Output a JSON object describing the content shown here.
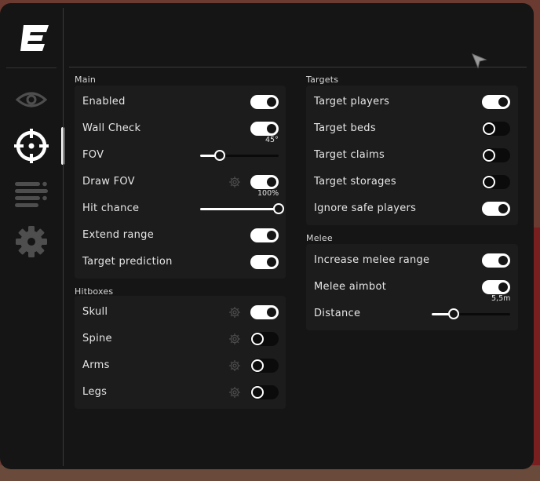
{
  "colors": {
    "accent": "#ffffff",
    "panel": "#1c1c1c",
    "window": "#151515",
    "text": "#e6e6e6"
  },
  "sidebar": {
    "logo": "E-logo",
    "items": [
      {
        "icon": "eye-icon",
        "active": false
      },
      {
        "icon": "crosshair-icon",
        "active": true
      },
      {
        "icon": "list-icon",
        "active": false
      },
      {
        "icon": "gear-icon",
        "active": false
      }
    ]
  },
  "main": {
    "title": "Main",
    "rows": [
      {
        "label": "Enabled",
        "type": "toggle",
        "on": true
      },
      {
        "label": "Wall Check",
        "type": "toggle",
        "on": true
      },
      {
        "label": "FOV",
        "type": "slider",
        "value_text": "45°",
        "fraction": 0.25
      },
      {
        "label": "Draw FOV",
        "type": "toggle",
        "on": true,
        "gear": true
      },
      {
        "label": "Hit chance",
        "type": "slider",
        "value_text": "100%",
        "fraction": 1.0
      },
      {
        "label": "Extend range",
        "type": "toggle",
        "on": true
      },
      {
        "label": "Target prediction",
        "type": "toggle",
        "on": true
      }
    ]
  },
  "hitboxes": {
    "title": "Hitboxes",
    "rows": [
      {
        "label": "Skull",
        "type": "toggle",
        "on": true,
        "gear": true
      },
      {
        "label": "Spine",
        "type": "toggle",
        "on": false,
        "gear": true
      },
      {
        "label": "Arms",
        "type": "toggle",
        "on": false,
        "gear": true
      },
      {
        "label": "Legs",
        "type": "toggle",
        "on": false,
        "gear": true
      }
    ]
  },
  "targets": {
    "title": "Targets",
    "rows": [
      {
        "label": "Target players",
        "type": "toggle",
        "on": true
      },
      {
        "label": "Target beds",
        "type": "toggle",
        "on": false
      },
      {
        "label": "Target claims",
        "type": "toggle",
        "on": false
      },
      {
        "label": "Target storages",
        "type": "toggle",
        "on": false
      },
      {
        "label": "Ignore safe players",
        "type": "toggle",
        "on": true
      }
    ]
  },
  "melee": {
    "title": "Melee",
    "rows": [
      {
        "label": "Increase melee range",
        "type": "toggle",
        "on": true
      },
      {
        "label": "Melee aimbot",
        "type": "toggle",
        "on": true
      },
      {
        "label": "Distance",
        "type": "slider",
        "value_text": "5,5m",
        "fraction": 0.28
      }
    ]
  }
}
